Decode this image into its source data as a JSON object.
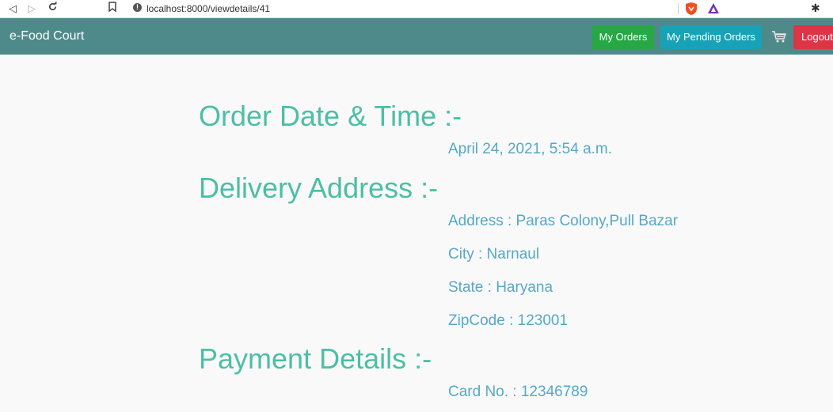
{
  "browser": {
    "url": "localhost:8000/viewdetails/41",
    "icons": [
      "back-icon",
      "forward-icon",
      "reload-icon",
      "bookmark-icon",
      "info-icon",
      "brave-shield-icon",
      "brave-rewards-icon",
      "extensions-icon"
    ]
  },
  "navbar": {
    "brand": "e-Food Court",
    "my_orders": "My Orders",
    "my_pending_orders": "My Pending Orders",
    "cart_icon": "cart-icon",
    "logout": "Logout"
  },
  "order": {
    "date_heading": "Order Date & Time :-",
    "date_value": "April 24, 2021, 5:54 a.m.",
    "delivery_heading": "Delivery Address :-",
    "address": "Address : Paras Colony,Pull Bazar",
    "city": "City : Narnaul",
    "state": "State : Haryana",
    "zipcode": "ZipCode : 123001",
    "payment_heading": "Payment Details :-",
    "card": "Card No. : 12346789"
  },
  "colors": {
    "navbar": "#4f8a8a",
    "heading": "#4bbfa5",
    "detail_text": "#56a8c9",
    "btn_orders": "#28a745",
    "btn_pending": "#17a2b8",
    "btn_logout": "#dc3545"
  }
}
